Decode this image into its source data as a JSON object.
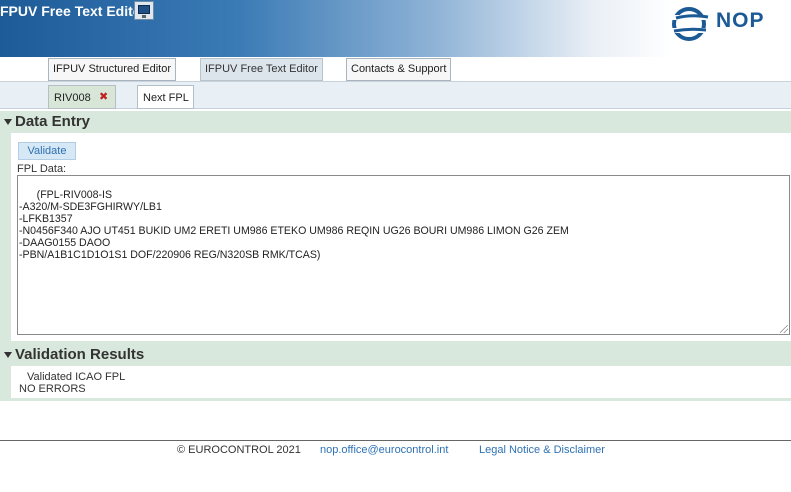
{
  "header": {
    "app_title": "FPUV Free Text Editor",
    "title_icon": "computer-monitor-icon",
    "logo_text": "NOP",
    "brand_color": "#1c5a96"
  },
  "main_tabs": [
    {
      "label": "IFPUV Structured Editor",
      "active": false
    },
    {
      "label": "IFPUV Free Text Editor",
      "active": true
    },
    {
      "label": "Contacts & Support",
      "active": false
    }
  ],
  "sub_tabs": [
    {
      "label": "RIV008",
      "active": true,
      "close_icon": "close-icon"
    },
    {
      "label": "Next FPL",
      "active": false
    }
  ],
  "data_entry": {
    "title": "Data Entry",
    "validate_label": "Validate",
    "fpl_label": "FPL Data:",
    "fpl_text": "(FPL-RIV008-IS\n-A320/M-SDE3FGHIRWY/LB1\n-LFKB1357\n-N0456F340 AJO UT451 BUKID UM2 ERETI UM986 ETEKO UM986 REQIN UG26 BOURI UM986 LIMON G26 ZEM\n-DAAG0155 DAOO\n-PBN/A1B1C1D1O1S1 DOF/220906 REG/N320SB RMK/TCAS)"
  },
  "validation": {
    "title": "Validation Results",
    "status_title": "Validated ICAO FPL",
    "status_text": "NO ERRORS"
  },
  "footer": {
    "copyright": "© EUROCONTROL 2021",
    "email": "nop.office@eurocontrol.int",
    "legal": "Legal Notice & Disclaimer"
  }
}
